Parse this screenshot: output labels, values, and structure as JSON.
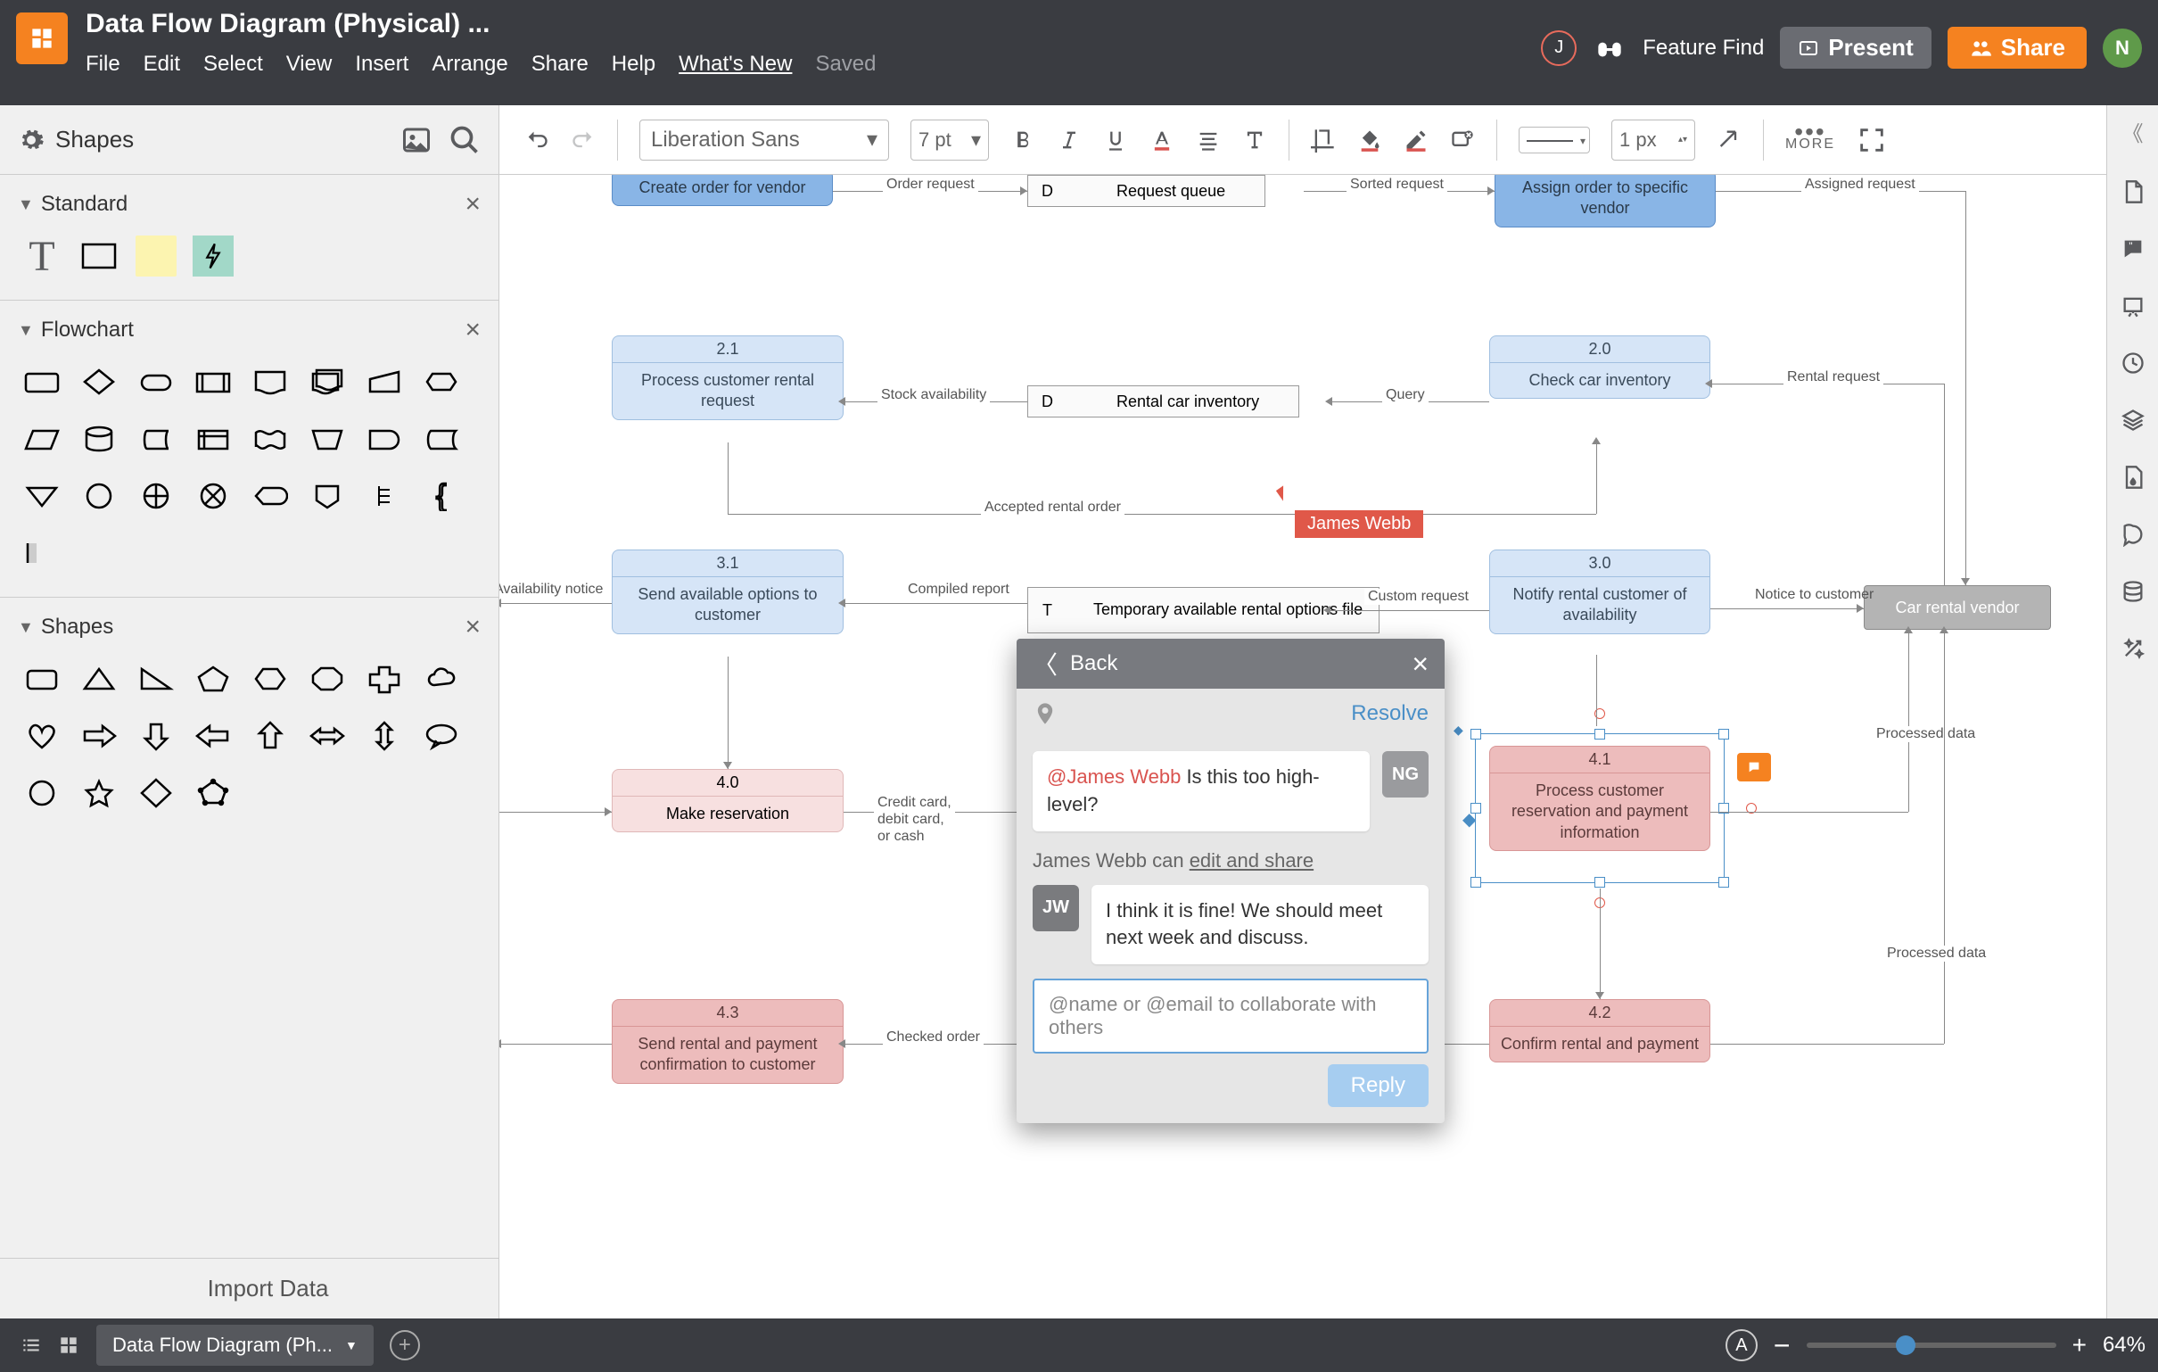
{
  "header": {
    "title": "Data Flow Diagram (Physical) ...",
    "menus": [
      "File",
      "Edit",
      "Select",
      "View",
      "Insert",
      "Arrange",
      "Share",
      "Help"
    ],
    "whatsnew": "What's New",
    "saved": "Saved",
    "feature_find": "Feature Find",
    "present": "Present",
    "share": "Share",
    "user_j": "J",
    "user_n": "N"
  },
  "sidebar": {
    "shapes": "Shapes",
    "standard": "Standard",
    "flowchart": "Flowchart",
    "shapes_section": "Shapes",
    "import": "Import Data"
  },
  "toolbar": {
    "font": "Liberation Sans",
    "size": "7 pt",
    "px": "1 px",
    "more": "MORE"
  },
  "canvas": {
    "n1": {
      "label": "Create order for vendor"
    },
    "n2": {
      "label": "Assign order to specific vendor"
    },
    "n21": {
      "id": "2.1",
      "label": "Process customer rental request"
    },
    "n20": {
      "id": "2.0",
      "label": "Check car inventory"
    },
    "n31": {
      "id": "3.1",
      "label": "Send available options to customer"
    },
    "n30": {
      "id": "3.0",
      "label": "Notify rental customer of availability"
    },
    "n40": {
      "id": "4.0",
      "label": "Make reservation"
    },
    "n41": {
      "id": "4.1",
      "label": "Process customer reservation and payment information"
    },
    "n43": {
      "id": "4.3",
      "label": "Send rental and payment confirmation to customer"
    },
    "n42": {
      "id": "4.2",
      "label": "Confirm rental and payment"
    },
    "vendor": "Car rental vendor",
    "ds1": {
      "letter": "D",
      "label": "Request queue"
    },
    "ds2": {
      "letter": "D",
      "label": "Rental car inventory"
    },
    "ds3": {
      "letter": "T",
      "label": "Temporary available rental options file"
    },
    "edges": {
      "order_request": "Order request",
      "sorted_request": "Sorted request",
      "assigned_request": "Assigned request",
      "stock_avail": "Stock availability",
      "query": "Query",
      "rental_request": "Rental request",
      "accepted": "Accepted rental order",
      "compiled": "Compiled report",
      "custom_request": "Custom request",
      "notice": "Notice to customer",
      "avail_notice": "Availability notice",
      "cc1": "Credit card,",
      "cc2": "debit card,",
      "cc3": "or cash",
      "processed_data": "Processed data",
      "processed_data2": "Processed data",
      "checked_order": "Checked order"
    },
    "cursor_tag": "James Webb"
  },
  "comments": {
    "back": "Back",
    "resolve": "Resolve",
    "c1_mention": "@James Webb",
    "c1_text": " Is this too high-level?",
    "ng": "NG",
    "edit_share_prefix": "James Webb can ",
    "edit_share_link": "edit and share",
    "jw": "JW",
    "c2_text": "I think it is fine! We should meet next week and discuss.",
    "placeholder": "@name or @email to collaborate with others",
    "reply": "Reply"
  },
  "footer": {
    "page": "Data Flow Diagram (Ph...",
    "zoom": "64%"
  }
}
